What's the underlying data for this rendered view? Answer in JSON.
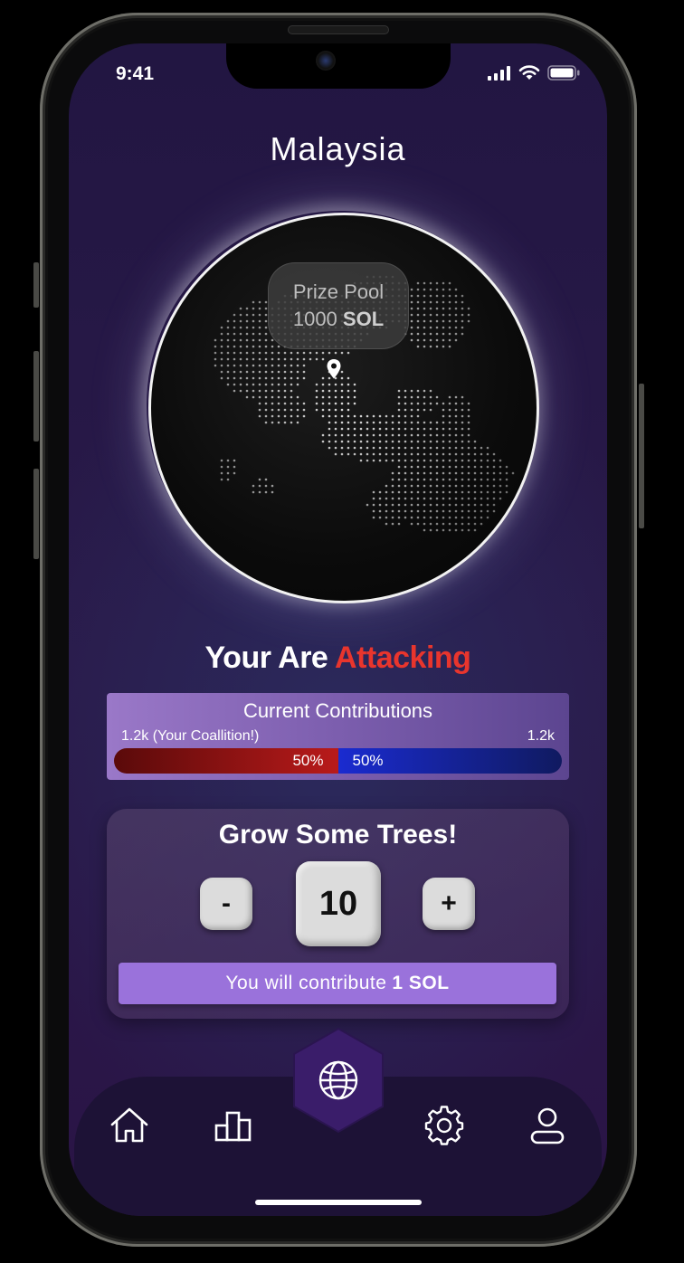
{
  "status_bar": {
    "time": "9:41"
  },
  "header": {
    "country": "Malaysia"
  },
  "globe": {
    "prize_label": "Prize Pool",
    "prize_amount": "1000",
    "prize_currency": "SOL",
    "marker_icon": "location-pin-icon"
  },
  "battle": {
    "prefix": "Your Are",
    "mode": "Attacking",
    "mode_color": "#e8352d"
  },
  "contributions": {
    "title": "Current Contributions",
    "left_label": "1.2k (Your Coallition!)",
    "right_label": "1.2k",
    "left_percent_label": "50%",
    "right_percent_label": "50%",
    "left_share": 0.5,
    "left_color": "#b91a1a",
    "right_color": "#1a2bd0"
  },
  "grow": {
    "title": "Grow Some Trees!",
    "minus_label": "-",
    "plus_label": "+",
    "quantity": "10",
    "contribute_prefix": "You will contribute",
    "contribute_amount": "1 SOL",
    "button_color": "#9a72db"
  },
  "tabbar": {
    "items": [
      {
        "icon": "home-icon"
      },
      {
        "icon": "bar-chart-icon"
      },
      {
        "icon": "globe-icon"
      },
      {
        "icon": "gear-icon"
      },
      {
        "icon": "user-icon"
      }
    ]
  }
}
